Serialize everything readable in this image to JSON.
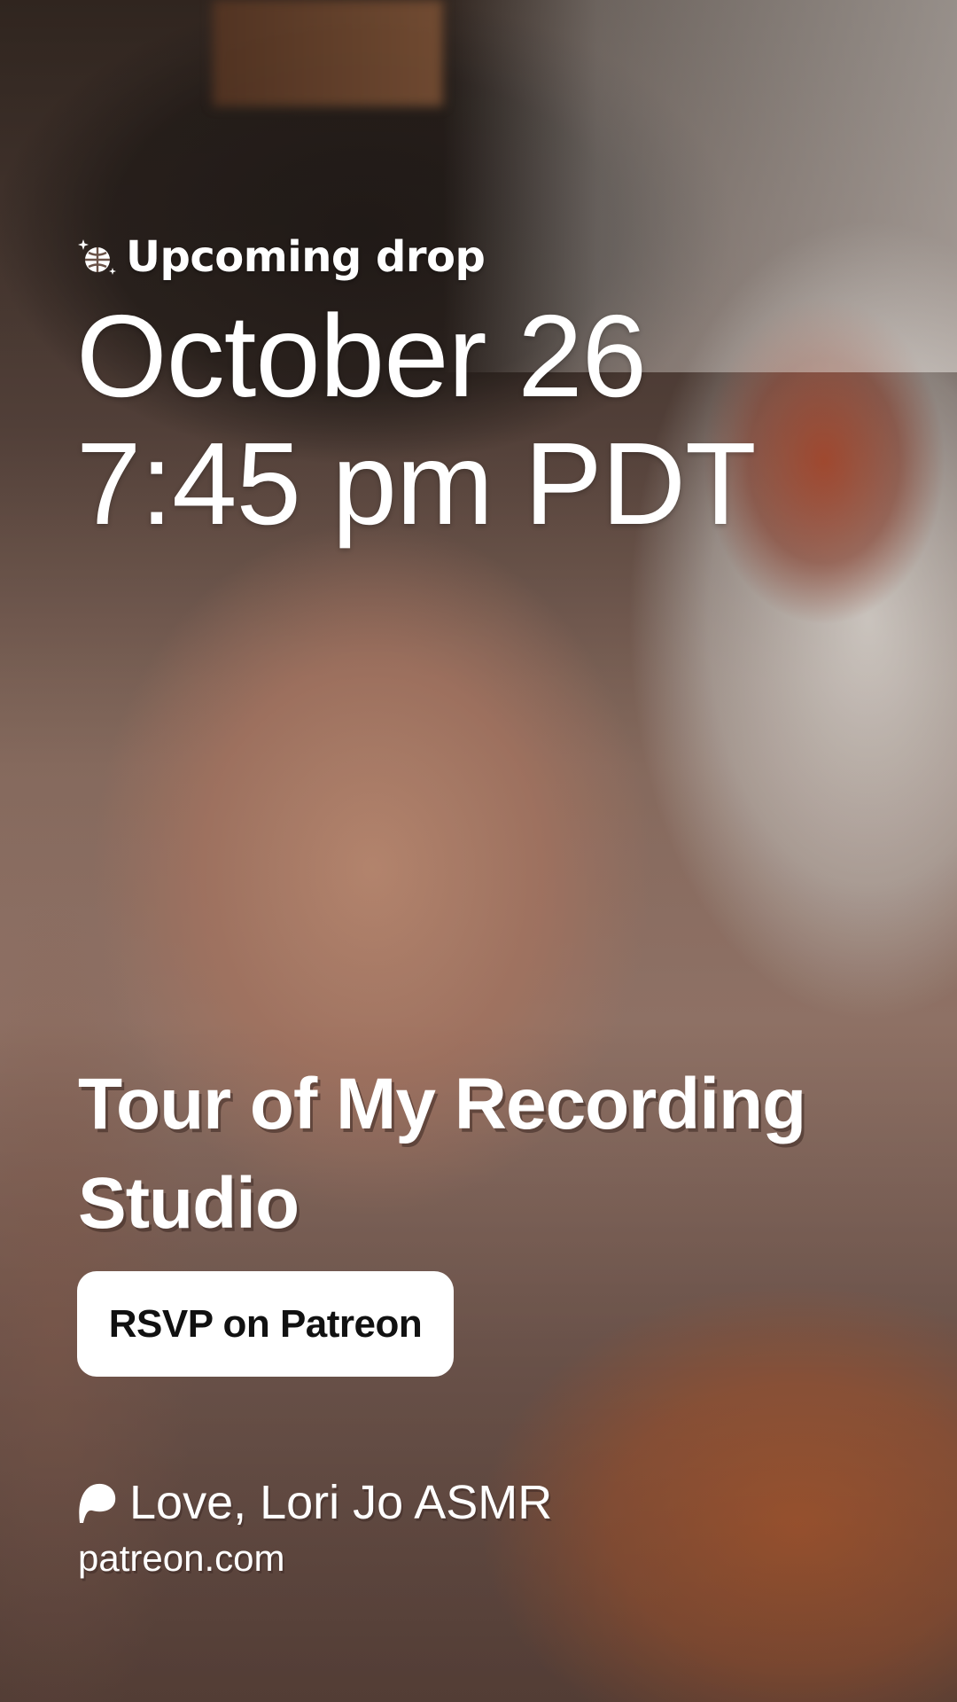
{
  "drop": {
    "eyebrow_icon": "disco-ball-sparkle-icon",
    "eyebrow_label": "Upcoming drop",
    "date_line": "October 26",
    "time_line": "7:45 pm PDT"
  },
  "post": {
    "title": "Tour of My Recording Studio"
  },
  "cta": {
    "label": "RSVP on Patreon"
  },
  "creator": {
    "logo_icon": "patreon-logo-icon",
    "name": "Love, Lori Jo ASMR",
    "domain": "patreon.com"
  },
  "colors": {
    "text": "#ffffff",
    "button_bg": "#ffffff",
    "button_text": "#111111"
  }
}
